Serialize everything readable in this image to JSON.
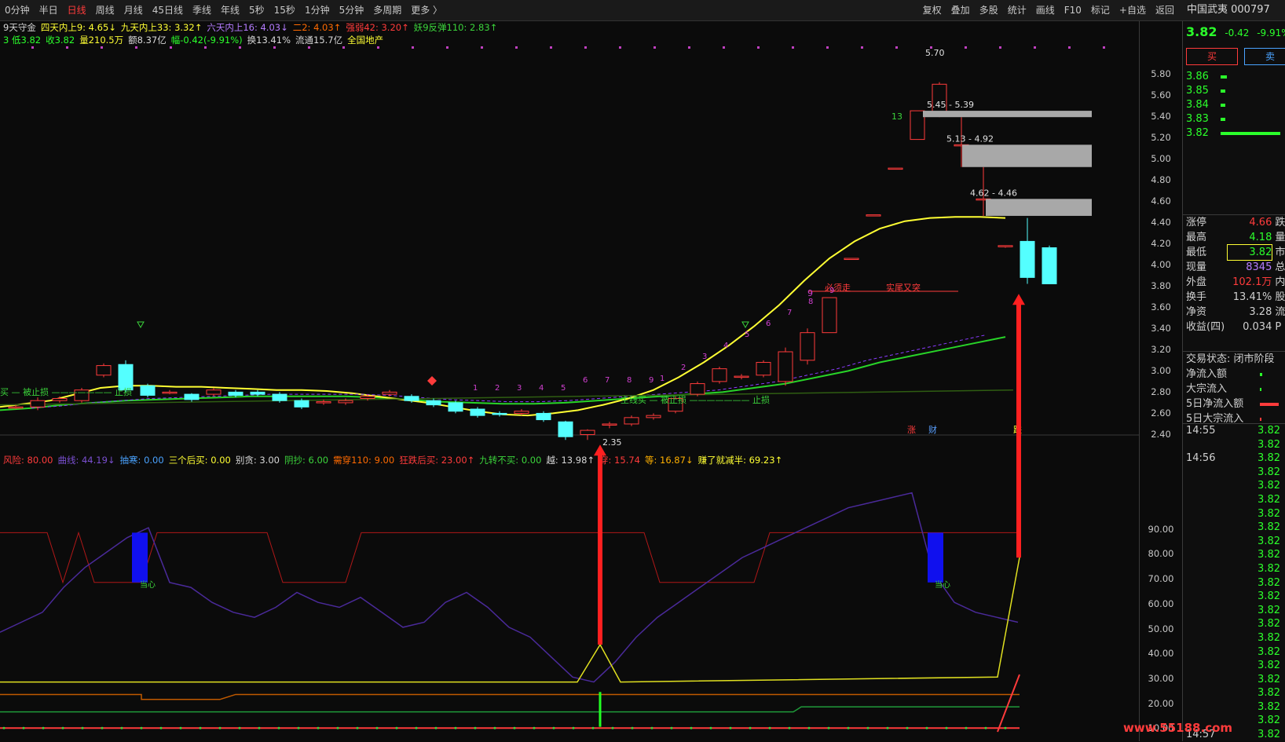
{
  "period_tabs": [
    "0分钟",
    "半日",
    "日线",
    "周线",
    "月线",
    "45日线",
    "季线",
    "年线",
    "5秒",
    "15秒",
    "1分钟",
    "5分钟",
    "多周期",
    "更多 〉"
  ],
  "active_tab": "日线",
  "tools": [
    "复权",
    "叠加",
    "多股",
    "统计",
    "画线",
    "F10",
    "标记",
    "+自选",
    "返回"
  ],
  "stock_title": "中国武夷 000797",
  "info_line1": [
    {
      "t": "9天守金",
      "c": "#d8d8d8"
    },
    {
      "t": "四天内上9: 4.65↓",
      "c": "#ffff33"
    },
    {
      "t": "九天内上33: 3.32↑",
      "c": "#ffff33"
    },
    {
      "t": "六天内上16: 4.03↓",
      "c": "#b57cff"
    },
    {
      "t": "二2: 4.03↑",
      "c": "#ff6a00"
    },
    {
      "t": "强弱42: 3.20↑",
      "c": "#ff3b3b"
    },
    {
      "t": "妖9反弹110: 2.83↑",
      "c": "#3bd43b"
    }
  ],
  "info_line2": [
    {
      "t": "3 低3.82",
      "c": "#2bff2b"
    },
    {
      "t": "收3.82",
      "c": "#2bff2b"
    },
    {
      "t": "量210.5万",
      "c": "#ffff33"
    },
    {
      "t": "额8.37亿",
      "c": "#d8d8d8"
    },
    {
      "t": "幅-0.42(-9.91%)",
      "c": "#2bff2b"
    },
    {
      "t": "换13.41%",
      "c": "#d8d8d8"
    },
    {
      "t": "流通15.7亿",
      "c": "#d8d8d8"
    },
    {
      "t": "全国地产",
      "c": "#ffff33"
    }
  ],
  "info_line3": [
    {
      "t": "风险: 80.00",
      "c": "#ff3b3b"
    },
    {
      "t": "曲线: 44.19↓",
      "c": "#7a4fd0"
    },
    {
      "t": "抽寒: 0.00",
      "c": "#4aa3ff"
    },
    {
      "t": "三个后买: 0.00",
      "c": "#ffff33"
    },
    {
      "t": "别贪: 3.00",
      "c": "#d8d8d8"
    },
    {
      "t": "阴抄: 6.00",
      "c": "#3bd43b"
    },
    {
      "t": "需穿110: 9.00",
      "c": "#ff6a00"
    },
    {
      "t": "狂跌后买: 23.00↑",
      "c": "#ff3b3b"
    },
    {
      "t": "九转不买: 0.00",
      "c": "#3bd43b"
    },
    {
      "t": "越: 13.98↑",
      "c": "#d8d8d8"
    },
    {
      "t": "穿: 15.74",
      "c": "#ff3b3b"
    },
    {
      "t": "等: 16.87↓",
      "c": "#ffb000"
    },
    {
      "t": "赚了就减半: 69.23↑",
      "c": "#ffff33"
    }
  ],
  "price_axis": [
    "5.80",
    "5.60",
    "5.40",
    "5.20",
    "5.00",
    "4.80",
    "4.60",
    "4.40",
    "4.20",
    "4.00",
    "3.80",
    "3.60",
    "3.40",
    "3.20",
    "3.00",
    "2.80",
    "2.60",
    "2.40"
  ],
  "ind_axis": [
    "90.00",
    "80.00",
    "70.00",
    "60.00",
    "50.00",
    "40.00",
    "30.00",
    "20.00",
    "10.00"
  ],
  "annotations": {
    "high": "5.70",
    "low": "2.35",
    "zone1": "5.45 - 5.39",
    "zone2": "5.13 - 4.92",
    "zone3": "4.62 - 4.46",
    "num13": "13",
    "left_label": "买 — 被止损 ——————— 止损",
    "mid_label": "主线买 — 被止损 ——————— 止损",
    "must_sell": "必须走",
    "real_tail": "实尾又突",
    "dangxin": "当心",
    "cal_zhang": "涨",
    "cal_cai": "财",
    "cal_end": "跌",
    "nine_count": "9",
    "counts": [
      "1",
      "2",
      "3",
      "4",
      "5",
      "6",
      "7",
      "8",
      "9"
    ],
    "right_counts": [
      "1",
      "2",
      "3",
      "4",
      "5",
      "6",
      "7",
      "8",
      "9"
    ]
  },
  "quote": {
    "price": "3.82",
    "chg": "-0.42",
    "pct": "-9.91%",
    "buy": "买",
    "sell": "卖"
  },
  "book": [
    {
      "p": "3.86",
      "w": 8
    },
    {
      "p": "3.85",
      "w": 6
    },
    {
      "p": "3.84",
      "w": 6
    },
    {
      "p": "3.83",
      "w": 6
    },
    {
      "p": "3.82",
      "w": 76
    }
  ],
  "stats": [
    {
      "k": "涨停",
      "v": "4.66",
      "vc": "#ff3b3b",
      "x": "跌"
    },
    {
      "k": "最高",
      "v": "4.18",
      "vc": "#2bff2b",
      "x": "量"
    },
    {
      "k": "最低",
      "v": "3.82",
      "vc": "#2bff2b",
      "x": "市"
    },
    {
      "k": "现量",
      "v": "8345",
      "vc": "#b57cff",
      "x": "总"
    },
    {
      "k": "外盘",
      "v": "102.1万",
      "vc": "#ff3b3b",
      "x": "内"
    },
    {
      "k": "换手",
      "v": "13.41%",
      "vc": "#d0d0d0",
      "x": "股"
    },
    {
      "k": "净资",
      "v": "3.28",
      "vc": "#d0d0d0",
      "x": "流"
    },
    {
      "k": "收益(四)",
      "v": "0.034",
      "vc": "#d0d0d0",
      "x": "P"
    }
  ],
  "trade_state": "交易状态: 闭市阶段",
  "flows": [
    {
      "k": "净流入额",
      "c": "#2bff2b",
      "w": 3
    },
    {
      "k": "大宗流入",
      "c": "#2bff2b",
      "w": 2
    },
    {
      "k": "5日净流入额",
      "c": "#ff3b3b",
      "w": 24
    },
    {
      "k": "5日大宗流入",
      "c": "#ff3b3b",
      "w": 2
    }
  ],
  "ticks": [
    {
      "t": "14:55",
      "p": "3.82"
    },
    {
      "t": "",
      "p": "3.82"
    },
    {
      "t": "14:56",
      "p": "3.82"
    },
    {
      "t": "",
      "p": "3.82"
    },
    {
      "t": "",
      "p": "3.82"
    },
    {
      "t": "",
      "p": "3.82"
    },
    {
      "t": "",
      "p": "3.82"
    },
    {
      "t": "",
      "p": "3.82"
    },
    {
      "t": "",
      "p": "3.82"
    },
    {
      "t": "",
      "p": "3.82"
    },
    {
      "t": "",
      "p": "3.82"
    },
    {
      "t": "",
      "p": "3.82"
    },
    {
      "t": "",
      "p": "3.82"
    },
    {
      "t": "",
      "p": "3.82"
    },
    {
      "t": "",
      "p": "3.82"
    },
    {
      "t": "",
      "p": "3.82"
    },
    {
      "t": "",
      "p": "3.82"
    },
    {
      "t": "",
      "p": "3.82"
    },
    {
      "t": "",
      "p": "3.82"
    },
    {
      "t": "",
      "p": "3.82"
    },
    {
      "t": "",
      "p": "3.82"
    },
    {
      "t": "",
      "p": "3.82"
    },
    {
      "t": "14:57",
      "p": "3.82"
    }
  ],
  "watermark": "www.55188.com",
  "chart_data": {
    "type": "candlestick",
    "price_ylim": [
      2.3,
      5.85
    ],
    "candles": [
      [
        2.66,
        2.66,
        2.64,
        2.68
      ],
      [
        2.66,
        2.72,
        2.63,
        2.75
      ],
      [
        2.72,
        2.74,
        2.7,
        2.76
      ],
      [
        2.72,
        2.82,
        2.7,
        2.84
      ],
      [
        2.96,
        3.05,
        2.94,
        3.07
      ],
      [
        3.06,
        2.82,
        2.8,
        3.1
      ],
      [
        2.86,
        2.77,
        2.75,
        2.88
      ],
      [
        2.8,
        2.8,
        2.78,
        2.82
      ],
      [
        2.78,
        2.73,
        2.71,
        2.79
      ],
      [
        2.78,
        2.82,
        2.76,
        2.84
      ],
      [
        2.8,
        2.77,
        2.75,
        2.82
      ],
      [
        2.8,
        2.78,
        2.76,
        2.82
      ],
      [
        2.78,
        2.72,
        2.7,
        2.8
      ],
      [
        2.72,
        2.66,
        2.64,
        2.74
      ],
      [
        2.7,
        2.71,
        2.68,
        2.73
      ],
      [
        2.7,
        2.72,
        2.68,
        2.74
      ],
      [
        2.74,
        2.76,
        2.72,
        2.78
      ],
      [
        2.78,
        2.8,
        2.76,
        2.82
      ],
      [
        2.76,
        2.72,
        2.7,
        2.78
      ],
      [
        2.72,
        2.68,
        2.66,
        2.74
      ],
      [
        2.7,
        2.62,
        2.6,
        2.72
      ],
      [
        2.64,
        2.58,
        2.56,
        2.66
      ],
      [
        2.6,
        2.59,
        2.57,
        2.62
      ],
      [
        2.6,
        2.62,
        2.58,
        2.64
      ],
      [
        2.6,
        2.54,
        2.52,
        2.62
      ],
      [
        2.52,
        2.38,
        2.35,
        2.53
      ],
      [
        2.4,
        2.44,
        2.35,
        2.45
      ],
      [
        2.49,
        2.5,
        2.46,
        2.52
      ],
      [
        2.5,
        2.56,
        2.48,
        2.58
      ],
      [
        2.56,
        2.58,
        2.54,
        2.6
      ],
      [
        2.62,
        2.74,
        2.6,
        2.76
      ],
      [
        2.78,
        2.88,
        2.76,
        2.9
      ],
      [
        2.9,
        3.02,
        2.88,
        3.04
      ],
      [
        2.94,
        2.95,
        2.92,
        2.97
      ],
      [
        2.96,
        3.08,
        2.94,
        3.1
      ],
      [
        2.9,
        3.18,
        2.86,
        3.22
      ],
      [
        3.1,
        3.36,
        3.06,
        3.4
      ],
      [
        3.36,
        3.69,
        3.36,
        3.69
      ],
      [
        4.06,
        4.06,
        4.06,
        4.06
      ],
      [
        4.47,
        4.47,
        4.47,
        4.47
      ],
      [
        4.91,
        4.91,
        4.91,
        4.91
      ],
      [
        5.18,
        5.45,
        5.18,
        5.45
      ],
      [
        5.42,
        5.7,
        5.39,
        5.72
      ],
      [
        5.13,
        5.13,
        4.92,
        5.39
      ],
      [
        4.62,
        4.62,
        4.46,
        4.92
      ],
      [
        4.18,
        4.18,
        4.16,
        4.18
      ],
      [
        4.22,
        3.88,
        3.82,
        4.44
      ],
      [
        4.16,
        3.82,
        3.82,
        4.18
      ]
    ],
    "ma_yellow": [
      2.66,
      2.69,
      2.72,
      2.78,
      2.84,
      2.86,
      2.86,
      2.85,
      2.85,
      2.84,
      2.83,
      2.82,
      2.82,
      2.81,
      2.79,
      2.76,
      2.73,
      2.7,
      2.66,
      2.62,
      2.59,
      2.58,
      2.6,
      2.63,
      2.68,
      2.74,
      2.82,
      2.94,
      3.08,
      3.24,
      3.42,
      3.62,
      3.85,
      4.06,
      4.22,
      4.34,
      4.41,
      4.44,
      4.45,
      4.45,
      4.44
    ],
    "ma_green": [
      2.63,
      2.65,
      2.68,
      2.7,
      2.72,
      2.73,
      2.74,
      2.75,
      2.76,
      2.76,
      2.76,
      2.76,
      2.75,
      2.73,
      2.71,
      2.7,
      2.69,
      2.69,
      2.7,
      2.72,
      2.74,
      2.76,
      2.78,
      2.8,
      2.84,
      2.88,
      2.94,
      3.0,
      3.08,
      3.14,
      3.2,
      3.26,
      3.32
    ],
    "indicator_ylim": [
      0,
      100
    ],
    "risk_line": [
      80,
      80,
      80,
      80,
      60,
      80,
      60,
      60,
      60,
      60,
      80,
      80,
      80,
      80,
      80,
      80,
      80,
      80,
      60,
      60,
      60,
      60,
      60,
      80,
      80,
      80,
      80,
      80,
      80,
      80,
      80,
      80,
      80,
      80,
      80,
      80,
      80,
      80,
      80,
      80,
      80,
      80,
      60,
      60,
      60,
      60,
      60,
      60,
      60,
      80,
      80,
      80,
      80,
      80,
      80,
      80,
      80,
      80,
      80,
      80,
      80,
      80,
      80,
      80,
      80,
      80
    ],
    "purple_line": [
      40,
      44,
      48,
      58,
      66,
      72,
      78,
      82,
      60,
      58,
      52,
      48,
      46,
      50,
      56,
      52,
      50,
      54,
      48,
      42,
      44,
      52,
      56,
      50,
      42,
      38,
      30,
      22,
      20,
      28,
      38,
      46,
      52,
      58,
      64,
      70,
      74,
      78,
      82,
      86,
      90,
      92,
      94,
      96,
      64,
      52,
      48,
      46,
      44
    ]
  }
}
